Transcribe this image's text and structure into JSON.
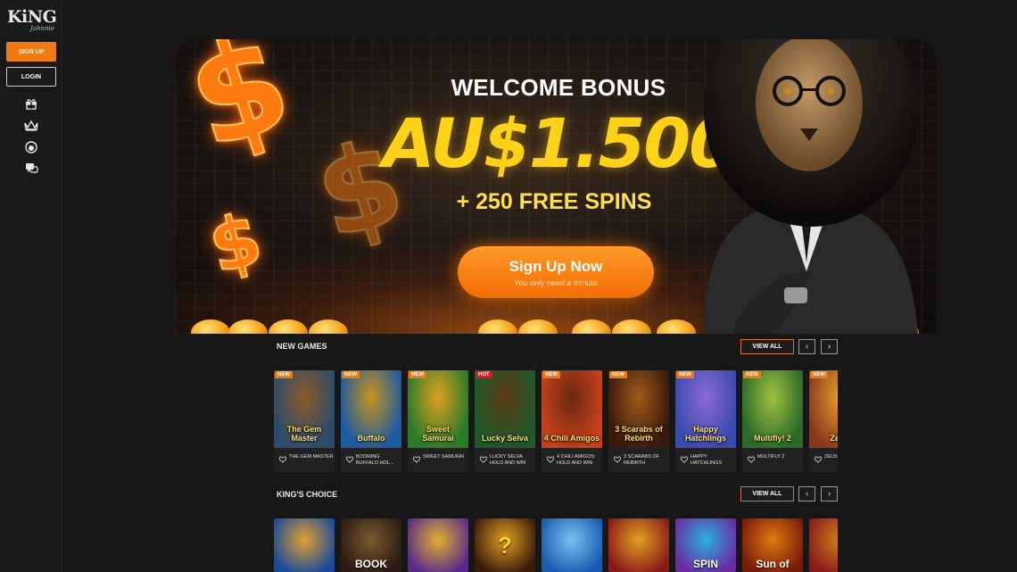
{
  "brand": {
    "name": "KiNG",
    "sub": "Johnnie"
  },
  "auth": {
    "signup_label": "SIGN UP",
    "login_label": "LOGIN"
  },
  "sidebar_icons": [
    "gift-icon",
    "crown-icon",
    "lion-icon",
    "chat-icon"
  ],
  "hero": {
    "welcome": "WELCOME BONUS",
    "amount": "AU$1.500",
    "spins": "+ 250 FREE SPINS",
    "cta_label": "Sign Up Now",
    "cta_sub": "You only need a minute"
  },
  "new_games": {
    "title": "NEW GAMES",
    "view_all": "VIEW ALL",
    "games": [
      {
        "name": "THE GEM MASTER",
        "badge": "NEW",
        "art": "The Gem Master",
        "c1": "#2d4b6a",
        "c2": "#8a5a2a"
      },
      {
        "name": "BOOMING BUFFALO HOL...",
        "badge": "NEW",
        "art": "Buffalo",
        "c1": "#1d5aa0",
        "c2": "#c8941c"
      },
      {
        "name": "SWEET SAMURAI",
        "badge": "NEW",
        "art": "Sweet Samurai",
        "c1": "#2a7a2a",
        "c2": "#e0a020"
      },
      {
        "name": "LUCKY SELVA HOLD AND WIN",
        "badge": "HOT",
        "art": "Lucky Selva",
        "c1": "#1f5a2a",
        "c2": "#5a3a12"
      },
      {
        "name": "4 CHILI AMIGOS: HOLD AND WIN",
        "badge": "NEW",
        "art": "4 Chili Amigos",
        "c1": "#c8401a",
        "c2": "#6a2a10"
      },
      {
        "name": "3 SCARABS OF REBIRTH",
        "badge": "NEW",
        "art": "3 Scarabs of Rebirth",
        "c1": "#3a1a0a",
        "c2": "#a05a1a"
      },
      {
        "name": "HAPPY HATCHLINGS",
        "badge": "NEW",
        "art": "Happy Hatchlings",
        "c1": "#3a4ab0",
        "c2": "#8a6ad0"
      },
      {
        "name": "MULTIFLY 2",
        "badge": "NEW",
        "art": "Multifly! 2",
        "c1": "#2a6a2a",
        "c2": "#a0c040"
      },
      {
        "name": "ZEUS FURY",
        "badge": "NEW",
        "art": "Zeus",
        "c1": "#8a3a1a",
        "c2": "#e0a030"
      }
    ]
  },
  "kings_choice": {
    "title": "KING'S CHOICE",
    "view_all": "VIEW ALL",
    "games": [
      {
        "art": "",
        "c1": "#1a4a9a",
        "c2": "#e0a030"
      },
      {
        "art": "BOOK",
        "c1": "#2a1a12",
        "c2": "#7a5a30"
      },
      {
        "art": "",
        "c1": "#5a2a8a",
        "c2": "#e0b030"
      },
      {
        "art": "?",
        "c1": "#3a1a0a",
        "c2": "#e0a020"
      },
      {
        "art": "",
        "c1": "#1a5ab0",
        "c2": "#7ac0f0"
      },
      {
        "art": "",
        "c1": "#8a1a1a",
        "c2": "#e0a020"
      },
      {
        "art": "SPIN",
        "c1": "#6a2aa0",
        "c2": "#2ab0e0"
      },
      {
        "art": "Sun of",
        "c1": "#7a1a0a",
        "c2": "#e07a10"
      },
      {
        "art": "",
        "c1": "#8a1a1a",
        "c2": "#d0801a"
      }
    ]
  },
  "colors": {
    "accent": "#f07a12",
    "gold": "#ffd21a",
    "background": "#171717"
  }
}
